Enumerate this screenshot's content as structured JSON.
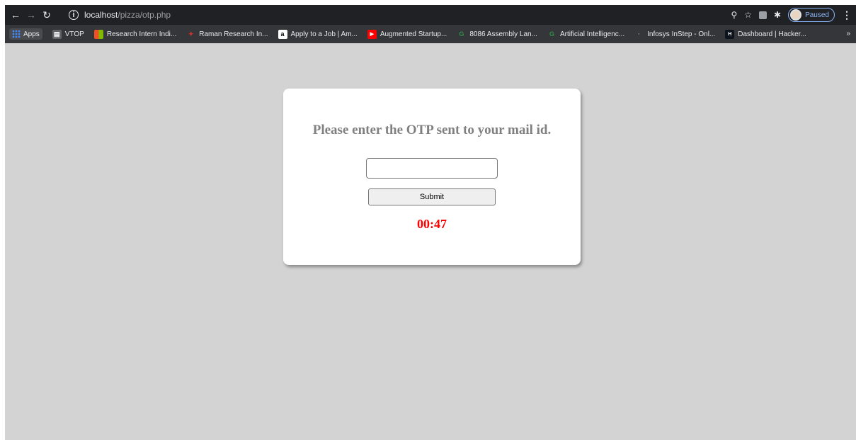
{
  "browser": {
    "url_host": "localhost",
    "url_path": "/pizza/otp.php",
    "profile_status": "Paused",
    "accent": "#8ab4f8"
  },
  "bookmarks": [
    {
      "label": "Apps",
      "icon": "apps-grid-icon"
    },
    {
      "label": "VTOP",
      "icon": "vtop-icon",
      "color": "#5f6368"
    },
    {
      "label": "Research Intern Indi...",
      "icon": "microsoft-icon",
      "color": "#f25022"
    },
    {
      "label": "Raman Research In...",
      "icon": "rri-icon",
      "color": "#d93025"
    },
    {
      "label": "Apply to a Job | Am...",
      "icon": "amazon-icon",
      "color": "#ffffff"
    },
    {
      "label": "Augmented Startup...",
      "icon": "youtube-icon",
      "color": "#ff0000"
    },
    {
      "label": "8086 Assembly Lan...",
      "icon": "gfg-icon",
      "color": "#2f8d46"
    },
    {
      "label": "Artificial Intelligenc...",
      "icon": "gfg-icon",
      "color": "#2f8d46"
    },
    {
      "label": "Infosys InStep - Onl...",
      "icon": "infosys-icon",
      "color": "#202124"
    },
    {
      "label": "Dashboard | Hacker...",
      "icon": "hackerrank-icon",
      "color": "#1ba94c"
    }
  ],
  "page": {
    "heading": "Please enter the OTP sent to your mail id.",
    "otp_value": "",
    "submit_label": "Submit",
    "timer": "00:47",
    "timer_color": "#ff0000",
    "background": "#d3d3d3"
  }
}
